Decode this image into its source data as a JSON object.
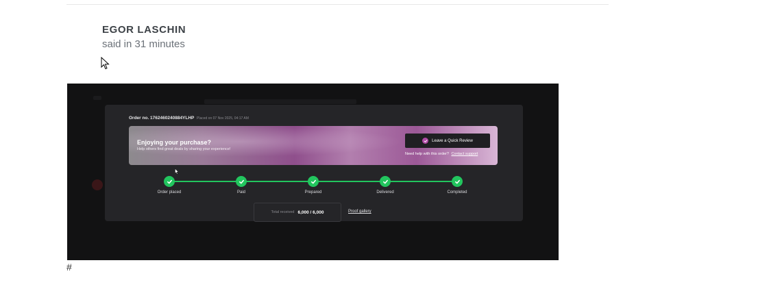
{
  "post": {
    "author": "EGOR LASCHIN",
    "meta": "said in 31 minutes"
  },
  "order": {
    "order_no": "Order no. 1762460240884YLHP",
    "placed_on": "Placed on 07 Nov 2025, 04:17 AM",
    "banner": {
      "title": "Enjoying your purchase?",
      "subtitle": "Help others find great deals by sharing your experience!",
      "review_button": "Leave a Quick Review",
      "help_text": "Need help with this order?",
      "help_link": "Contact support"
    },
    "steps": [
      {
        "label": "Order placed"
      },
      {
        "label": "Paid"
      },
      {
        "label": "Prepared"
      },
      {
        "label": "Delivered"
      },
      {
        "label": "Completed"
      }
    ],
    "total_label": "Total received",
    "total_value": "6,000 / 6,000",
    "proof_link": "Proof gallery"
  },
  "footer": {
    "hash": "#"
  },
  "colors": {
    "accent_green": "#22c55e",
    "accent_purple": "#b049a6",
    "card_bg": "#252528"
  }
}
